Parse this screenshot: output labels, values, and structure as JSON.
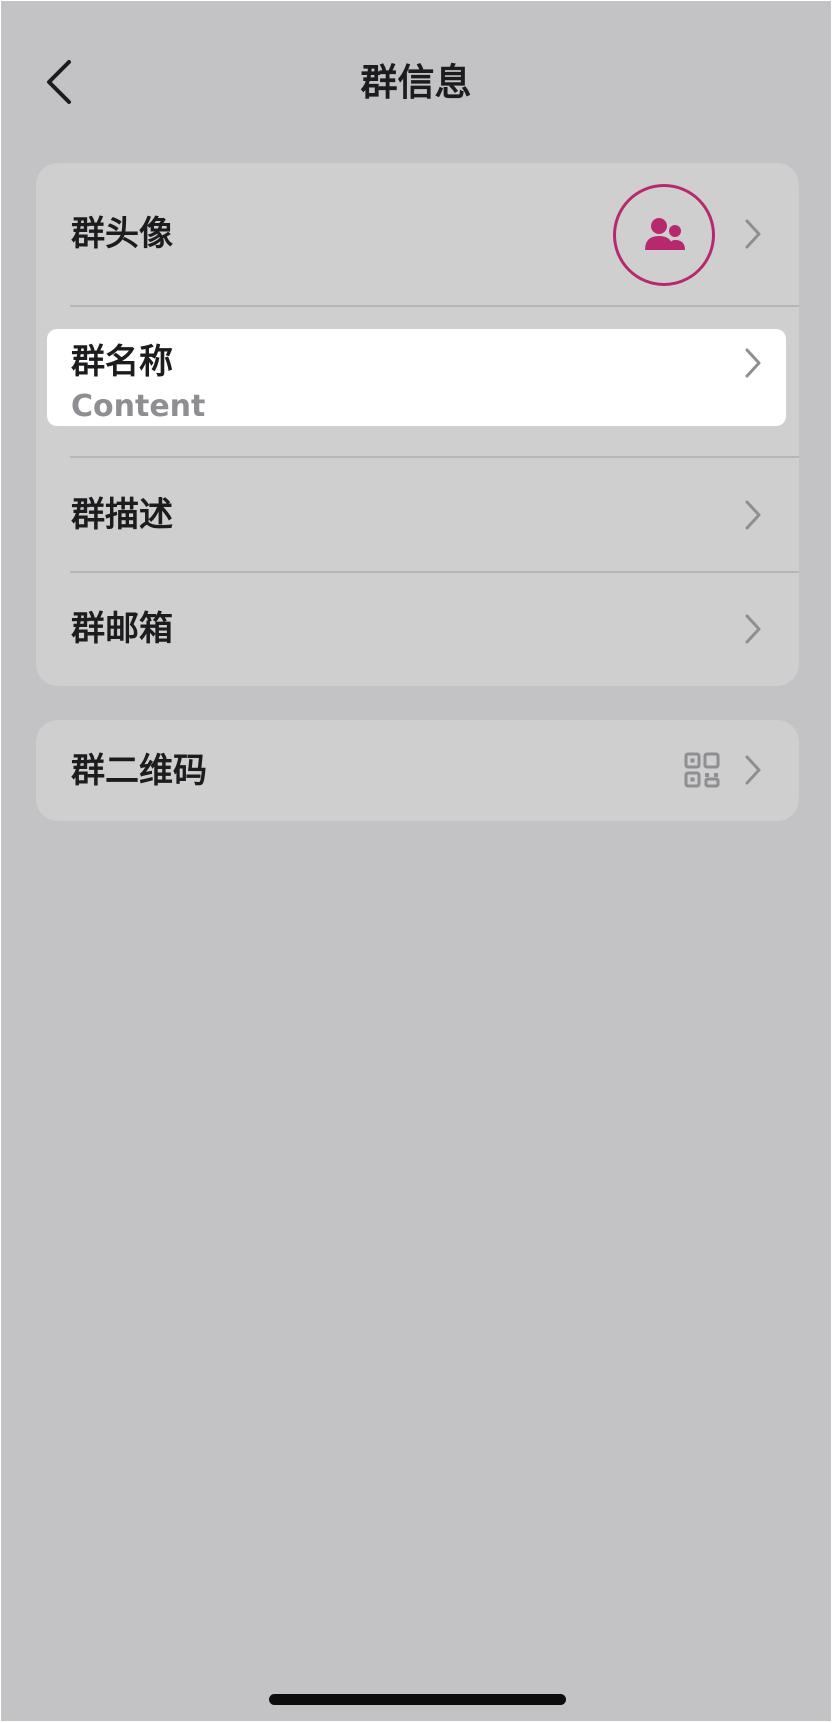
{
  "header": {
    "title": "群信息",
    "back_icon": "chevron-left-icon"
  },
  "group_info": {
    "avatar": {
      "label": "群头像",
      "icon": "group-users-icon",
      "accent_color": "#b7296f"
    },
    "name": {
      "label": "群名称",
      "value": "Content"
    },
    "description": {
      "label": "群描述"
    },
    "email": {
      "label": "群邮箱"
    }
  },
  "qr_section": {
    "label": "群二维码",
    "icon": "qr-code-icon"
  },
  "colors": {
    "background": "#c3c3c6",
    "card": "#cfcfcf",
    "highlight": "#ffffff",
    "text_primary": "#1c1c1e",
    "text_secondary": "#8e8e93",
    "chevron": "#8e8e93"
  }
}
